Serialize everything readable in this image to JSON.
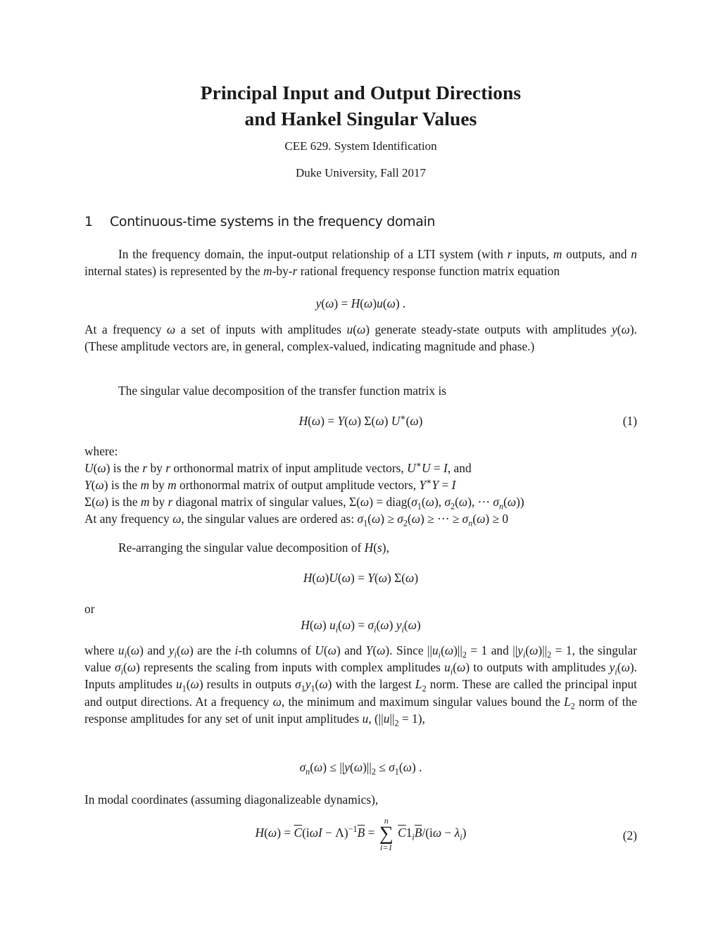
{
  "header": {
    "title_line1": "Principal Input and Output Directions",
    "title_line2": "and Hankel Singular Values",
    "course": "CEE 629. System Identification",
    "affiliation": "Duke University, Fall 2017"
  },
  "section": {
    "number": "1",
    "title": "Continuous-time systems in the frequency domain"
  },
  "body": {
    "p1": "In the frequency domain, the input-output relationship of a LTI system (with <i>r</i> inputs, <i>m</i> outputs, and <i>n</i> internal states) is represented by the <i>m</i>-by-<i>r</i> rational frequency response function matrix equation",
    "eq_io": "<i>y</i>(<i>ω</i>) = <i>H</i>(<i>ω</i>)<i>u</i>(<i>ω</i>) .",
    "p2": "At a frequency <i>ω</i> a set of inputs with amplitudes <i>u</i>(<i>ω</i>) generate steady-state outputs with amplitudes <i>y</i>(<i>ω</i>). (These amplitude vectors are, in general, complex-valued, indicating magnitude and phase.)",
    "p3": "The singular value decomposition of the transfer function matrix is",
    "eq1": "<i>H</i>(<i>ω</i>) = <i>Y</i>(<i>ω</i>) Σ(<i>ω</i>) <i>U</i><sup>∗</sup>(<i>ω</i>)",
    "eq1_number": "(1)",
    "where_label": "where:",
    "where_items": [
      "<i>U</i>(<i>ω</i>) is the <i>r</i> by <i>r</i> orthonormal matrix of input amplitude vectors, <i>U</i><sup>∗</sup><i>U</i> = <i>I</i>, and",
      "<i>Y</i>(<i>ω</i>) is the <i>m</i> by <i>m</i> orthonormal matrix of output amplitude vectors, <i>Y</i><sup>∗</sup><i>Y</i> = <i>I</i>",
      "Σ(<i>ω</i>) is the <i>m</i> by <i>r</i> diagonal matrix of singular values, Σ(<i>ω</i>) = diag(<i>σ</i><sub>1</sub>(<i>ω</i>), <i>σ</i><sub>2</sub>(<i>ω</i>), ··· <i>σ</i><sub><i>n</i></sub>(<i>ω</i>))",
      "At any frequency <i>ω</i>, the singular values are ordered as: <i>σ</i><sub>1</sub>(<i>ω</i>) ≥ <i>σ</i><sub>2</sub>(<i>ω</i>) ≥ ··· ≥ <i>σ</i><sub><i>n</i></sub>(<i>ω</i>) ≥ 0"
    ],
    "p4": "Re-arranging the singular value decomposition of <i>H</i>(<i>s</i>),",
    "eq_rearr": "<i>H</i>(<i>ω</i>)<i>U</i>(<i>ω</i>) = <i>Y</i>(<i>ω</i>) Σ(<i>ω</i>)",
    "or_label": "or",
    "eq_col": "<i>H</i>(<i>ω</i>) <i>u<sub>i</sub></i>(<i>ω</i>) = <i>σ<sub>i</sub></i>(<i>ω</i>) <i>y<sub>i</sub></i>(<i>ω</i>)",
    "p5": "where <i>u<sub>i</sub></i>(<i>ω</i>) and <i>y<sub>i</sub></i>(<i>ω</i>) are the <i>i</i>-th columns of <i>U</i>(<i>ω</i>) and <i>Y</i>(<i>ω</i>). Since ||<i>u<sub>i</sub></i>(<i>ω</i>)||<sub>2</sub> = 1 and ||<i>y<sub>i</sub></i>(<i>ω</i>)||<sub>2</sub> = 1, the singular value <i>σ<sub>i</sub></i>(<i>ω</i>) represents the scaling from inputs with complex amplitudes <i>u<sub>i</sub></i>(<i>ω</i>) to outputs with amplitudes <i>y<sub>i</sub></i>(<i>ω</i>). Inputs amplitudes <i>u</i><sub>1</sub>(<i>ω</i>) results in outputs <i>σ</i><sub>1</sub><i>y</i><sub>1</sub>(<i>ω</i>) with the largest <i>L</i><sub>2</sub> norm. These are called the principal input and output directions. At a frequency <i>ω</i>, the minimum and maximum singular values bound the <i>L</i><sub>2</sub> norm of the response amplitudes for any set of unit input amplitudes <i>u</i>, (||<i>u</i>||<sub>2</sub> = 1),",
    "eq_bound": "<i>σ<sub>n</sub></i>(<i>ω</i>) ≤ ||<i>y</i>(<i>ω</i>)||<sub>2</sub> ≤ <i>σ</i><sub>1</sub>(<i>ω</i>) .",
    "p6": "In modal coordinates (assuming diagonalizeable dynamics),",
    "eq2_lhs": "<i>H</i>(<i>ω</i>) = <i class=\"bar\">C</i>(i<i>ωI</i> − Λ)<sup>−1</sup><i class=\"bar\">B</i> =",
    "eq2_sum_top": "n",
    "eq2_sum_sym": "∑",
    "eq2_sum_bot": "i=1",
    "eq2_rhs": "<i class=\"bar\">C</i>1<sub><i>i</i></sub><i class=\"bar\">B</i>/(i<i>ω</i> − <i>λ<sub>i</sub></i>)",
    "eq2_number": "(2)"
  }
}
